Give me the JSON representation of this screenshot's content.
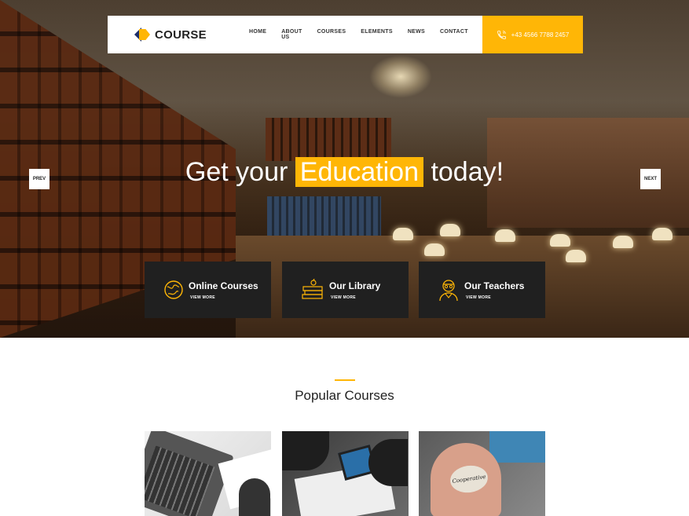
{
  "nav": {
    "logo_text": "COURSE",
    "items": [
      "HOME",
      "ABOUT US",
      "COURSES",
      "ELEMENTS",
      "NEWS",
      "CONTACT"
    ],
    "phone": "+43 4566 7788 2457"
  },
  "hero": {
    "headline_before": "Get your",
    "headline_highlight": "Education",
    "headline_after": "today!",
    "prev_label": "PREV",
    "next_label": "NEXT"
  },
  "features": [
    {
      "title": "Online Courses",
      "link": "VIEW MORE",
      "icon": "globe-icon"
    },
    {
      "title": "Our Library",
      "link": "VIEW MORE",
      "icon": "books-icon"
    },
    {
      "title": "Our Teachers",
      "link": "VIEW MORE",
      "icon": "teacher-icon"
    }
  ],
  "popular": {
    "title": "Popular Courses",
    "card3_stone_text": "Cooperative"
  },
  "colors": {
    "accent": "#ffb606",
    "dark_box": "#202020",
    "logo_blue": "#1c2e6b"
  }
}
